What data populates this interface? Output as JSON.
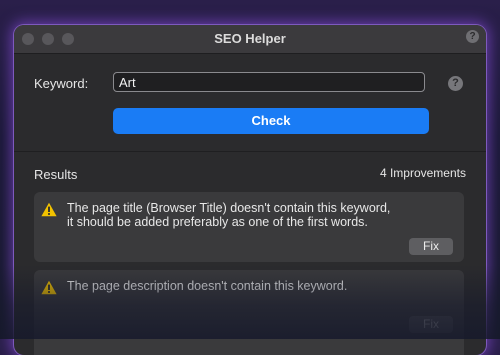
{
  "window": {
    "title": "SEO Helper",
    "help_glyph": "?"
  },
  "form": {
    "keyword_label": "Keyword:",
    "keyword_value": "Art",
    "help_glyph": "?",
    "check_label": "Check"
  },
  "results": {
    "heading": "Results",
    "count": "4 Improvements",
    "items": [
      {
        "line1": "The page title (Browser Title) doesn't contain this keyword,",
        "line2": "it should be added preferably as one of the first words.",
        "fix_label": "Fix"
      },
      {
        "line1": "The page description doesn't contain this keyword.",
        "fix_label": "Fix"
      }
    ]
  },
  "colors": {
    "accent": "#1a7cf5",
    "warning": "#f2c200",
    "window_bg": "#2b2b2d",
    "glow": "#a05aff"
  },
  "icons": [
    "warning-icon",
    "help-icon",
    "traffic-light"
  ]
}
